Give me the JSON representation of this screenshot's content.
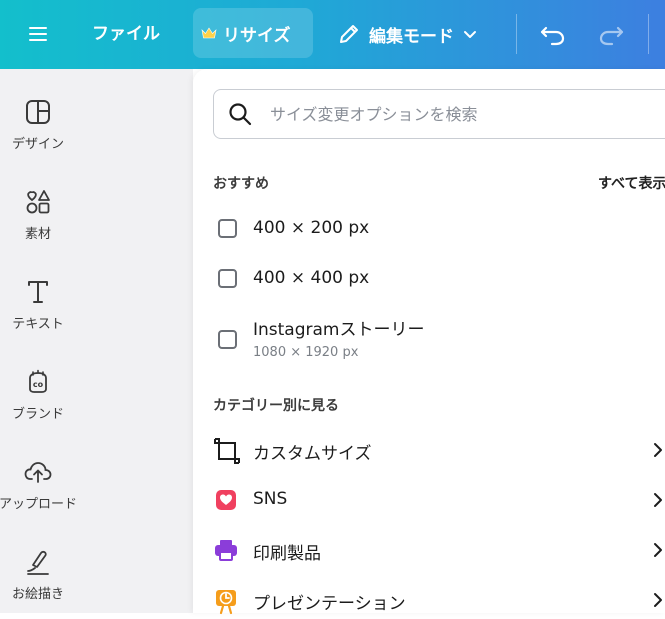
{
  "toolbar": {
    "file_label": "ファイル",
    "resize_label": "リサイズ",
    "edit_mode_label": "編集モード"
  },
  "sidebar": {
    "items": [
      {
        "label": "デザイン",
        "icon": "design-icon"
      },
      {
        "label": "素材",
        "icon": "elements-icon"
      },
      {
        "label": "テキスト",
        "icon": "text-icon"
      },
      {
        "label": "ブランド",
        "icon": "brand-icon"
      },
      {
        "label": "アップロード",
        "icon": "upload-icon"
      },
      {
        "label": "お絵描き",
        "icon": "draw-icon"
      }
    ]
  },
  "panel": {
    "search_placeholder": "サイズ変更オプションを検索",
    "recommended_title": "おすすめ",
    "show_all_label": "すべて表示",
    "recommended": [
      {
        "label": "400 × 200 px"
      },
      {
        "label": "400 × 400 px"
      },
      {
        "label": "Instagramストーリー",
        "sub": "1080 × 1920 px"
      }
    ],
    "category_title": "カテゴリー別に見る",
    "categories": [
      {
        "label": "カスタムサイズ",
        "icon": "custom-size-icon",
        "color": "#1c1c1c"
      },
      {
        "label": "SNS",
        "icon": "heart-icon",
        "color": "#f0405f"
      },
      {
        "label": "印刷製品",
        "icon": "printer-icon",
        "color": "#8b3dd9"
      },
      {
        "label": "プレゼンテーション",
        "icon": "presentation-icon",
        "color": "#f59d1b"
      }
    ]
  }
}
